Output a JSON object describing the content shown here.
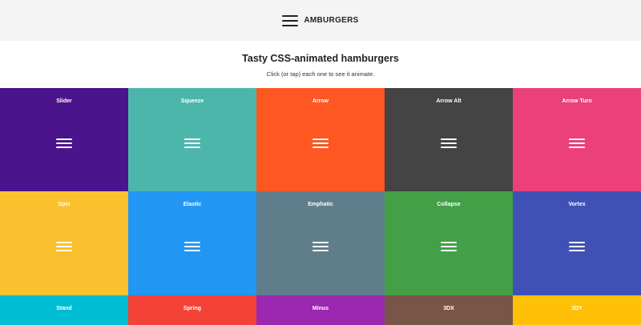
{
  "header": {
    "brand": "AMBURGERS"
  },
  "intro": {
    "title": "Tasty CSS-animated hamburgers",
    "subtitle": "Click (or tap) each one to see it animate."
  },
  "tiles": [
    {
      "label": "Slider",
      "color": "#4a148c"
    },
    {
      "label": "Squeeze",
      "color": "#4db6ac"
    },
    {
      "label": "Arrow",
      "color": "#ff5722"
    },
    {
      "label": "Arrow Alt",
      "color": "#444444"
    },
    {
      "label": "Arrow Turn",
      "color": "#ec407a"
    },
    {
      "label": "Spin",
      "color": "#fbc02d"
    },
    {
      "label": "Elastic",
      "color": "#2196f3"
    },
    {
      "label": "Emphatic",
      "color": "#607d8b"
    },
    {
      "label": "Collapse",
      "color": "#43a047"
    },
    {
      "label": "Vortex",
      "color": "#3f51b5"
    },
    {
      "label": "Stand",
      "color": "#00bcd4"
    },
    {
      "label": "Spring",
      "color": "#f44336"
    },
    {
      "label": "Minus",
      "color": "#9c27b0"
    },
    {
      "label": "3DX",
      "color": "#795548"
    },
    {
      "label": "3DY",
      "color": "#ffc107"
    }
  ]
}
